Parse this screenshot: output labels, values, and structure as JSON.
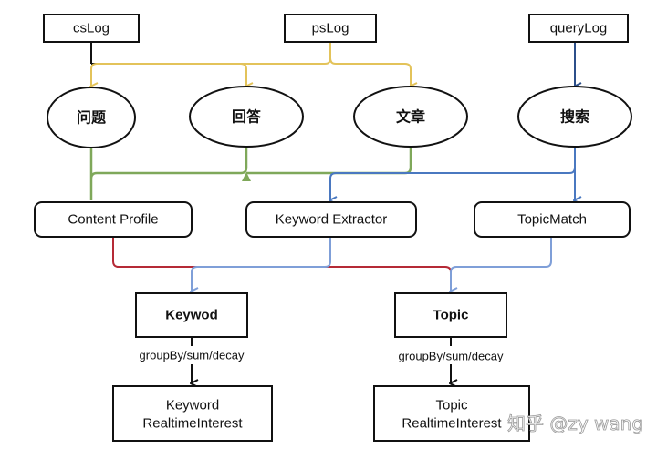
{
  "colors": {
    "yellow": "#e3c35a",
    "green": "#7fa85a",
    "blue": "#4a78c0",
    "lightblue": "#7f9fd8",
    "red": "#b52a36",
    "darkblue": "#2c4f8a"
  },
  "sources": {
    "cslog": "csLog",
    "pslog": "psLog",
    "querylog": "queryLog"
  },
  "entities": {
    "question": "问题",
    "answer": "回答",
    "article": "文章",
    "search": "搜索"
  },
  "processors": {
    "content_profile": "Content Profile",
    "keyword_extractor": "Keyword Extractor",
    "topic_match": "TopicMatch"
  },
  "outputs": {
    "keyword": "Keywod",
    "topic": "Topic"
  },
  "edge_labels": {
    "keyword_agg": "groupBy/sum/decay",
    "topic_agg": "groupBy/sum/decay"
  },
  "results": {
    "keyword_line1": "Keyword",
    "keyword_line2": "RealtimeInterest",
    "topic_line1": "Topic",
    "topic_line2": "RealtimeInterest"
  },
  "watermark": "知乎 @zy wang"
}
